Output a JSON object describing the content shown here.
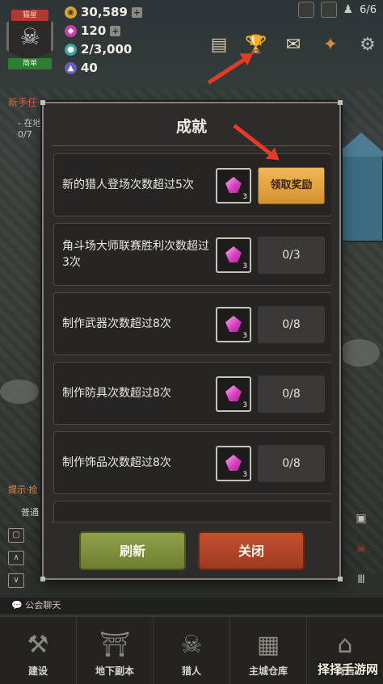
{
  "hud": {
    "rank_label": "猫星",
    "level_label": "简单",
    "gold": "30,589",
    "gems": "120",
    "population": "2/3,000",
    "mana": "40",
    "hunter_count": "6/6"
  },
  "quest": {
    "title": "新手任",
    "sub": "- 在地",
    "count": "0/7"
  },
  "dialog": {
    "title": "成就",
    "rows": [
      {
        "text": "新的猎人登场次数超过5次",
        "reward_count": "3",
        "action": "领取奖励",
        "claimable": true
      },
      {
        "text": "角斗场大师联赛胜利次数超过3次",
        "reward_count": "3",
        "action": "0/3",
        "claimable": false
      },
      {
        "text": "制作武器次数超过8次",
        "reward_count": "3",
        "action": "0/8",
        "claimable": false
      },
      {
        "text": "制作防具次数超过8次",
        "reward_count": "3",
        "action": "0/8",
        "claimable": false
      },
      {
        "text": "制作饰品次数超过8次",
        "reward_count": "3",
        "action": "0/8",
        "claimable": false
      }
    ],
    "refresh_label": "刷新",
    "close_label": "关闭"
  },
  "chat": {
    "label": "公会聊天",
    "tab": "普通",
    "hint": "提示·捡"
  },
  "nav": {
    "items": [
      {
        "label": "建设",
        "icon": "hammer-icon"
      },
      {
        "label": "地下副本",
        "icon": "dungeon-gate-icon"
      },
      {
        "label": "猎人",
        "icon": "hunter-emblem-icon"
      },
      {
        "label": "主城仓库",
        "icon": "warehouse-chest-icon"
      },
      {
        "label": "商店",
        "icon": "shop-icon"
      }
    ]
  },
  "watermark": "择择手游网",
  "colors": {
    "claim_button": "#d5922e",
    "refresh_button": "#6e7f31",
    "close_button": "#9e3a1f",
    "gem": "#d93fc0",
    "arrow": "#e53b24"
  }
}
